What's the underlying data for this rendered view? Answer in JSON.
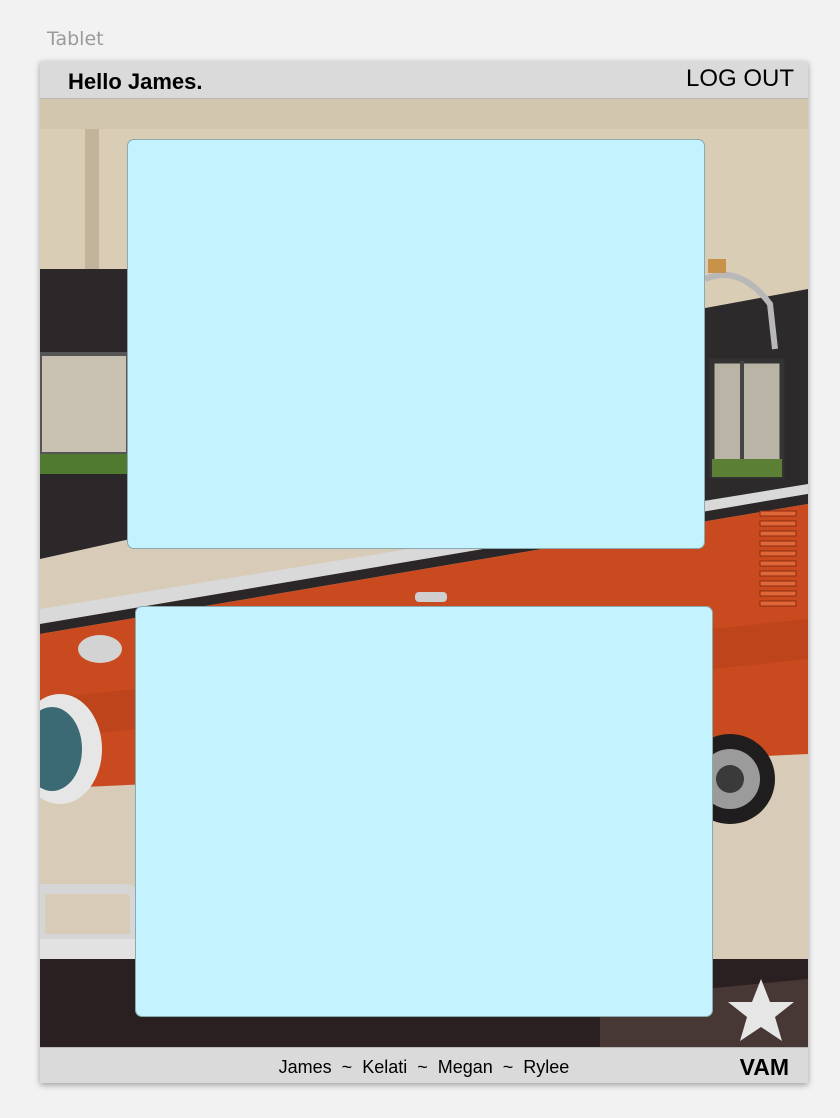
{
  "frame": {
    "label": "Tablet"
  },
  "header": {
    "greeting": "Hello James.",
    "logout_label": "LOG OUT"
  },
  "background": {
    "image": "orange-vintage-van-photo-icon",
    "accent_color": "#c84a1e"
  },
  "panels": [
    {
      "color": "#c4f2ff"
    },
    {
      "color": "#c4f2ff"
    }
  ],
  "footer": {
    "names": [
      "James",
      "Kelati",
      "Megan",
      "Rylee"
    ],
    "separator": "~",
    "brand": "VAM"
  },
  "favorite": {
    "icon": "star-icon"
  }
}
